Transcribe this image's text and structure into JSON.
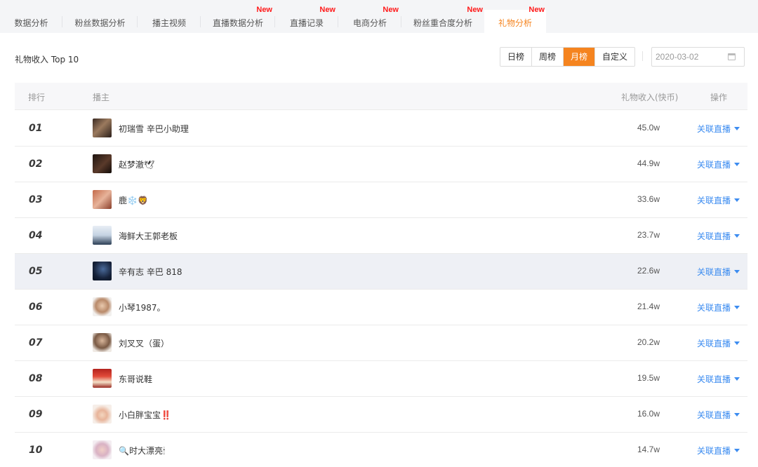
{
  "tabs": [
    {
      "label": "数据分析",
      "new": ""
    },
    {
      "label": "粉丝数据分析",
      "new": ""
    },
    {
      "label": "播主视频",
      "new": ""
    },
    {
      "label": "直播数据分析",
      "new": "New"
    },
    {
      "label": "直播记录",
      "new": "New"
    },
    {
      "label": "电商分析",
      "new": "New"
    },
    {
      "label": "粉丝重合度分析",
      "new": "New"
    },
    {
      "label": "礼物分析",
      "new": "New"
    }
  ],
  "active_tab": 7,
  "section_title": "礼物收入 Top 10",
  "range_buttons": [
    "日榜",
    "周榜",
    "月榜",
    "自定义"
  ],
  "active_range": 2,
  "date_value": "2020-03-02",
  "table": {
    "headers": {
      "rank": "排行",
      "streamer": "播主",
      "income": "礼物收入(快币)",
      "action": "操作"
    },
    "rows": [
      {
        "rank": "01",
        "name": "初瑞雪 辛巴小助理",
        "income": "45.0w",
        "action": "关联直播"
      },
      {
        "rank": "02",
        "name": "赵梦澈🕊",
        "income": "44.9w",
        "action": "关联直播"
      },
      {
        "rank": "03",
        "name": "鹿❄️🦁",
        "income": "33.6w",
        "action": "关联直播"
      },
      {
        "rank": "04",
        "name": "海鲜大王郭老板",
        "income": "23.7w",
        "action": "关联直播"
      },
      {
        "rank": "05",
        "name": "辛有志 辛巴 818",
        "income": "22.6w",
        "action": "关联直播"
      },
      {
        "rank": "06",
        "name": "小琴1987。",
        "income": "21.4w",
        "action": "关联直播"
      },
      {
        "rank": "07",
        "name": "刘叉叉（蛋）",
        "income": "20.2w",
        "action": "关联直播"
      },
      {
        "rank": "08",
        "name": "东哥说鞋",
        "income": "19.5w",
        "action": "关联直播"
      },
      {
        "rank": "09",
        "name": "小白胖宝宝‼️",
        "income": "16.0w",
        "action": "关联直播"
      },
      {
        "rank": "10",
        "name": "🔍时大漂亮🕯",
        "income": "14.7w",
        "action": "关联直播"
      }
    ]
  },
  "colors": {
    "accent": "#f5841f",
    "link": "#3c8cf0",
    "new_badge": "#ff1a1a",
    "hover_row": "#eef0f5"
  }
}
